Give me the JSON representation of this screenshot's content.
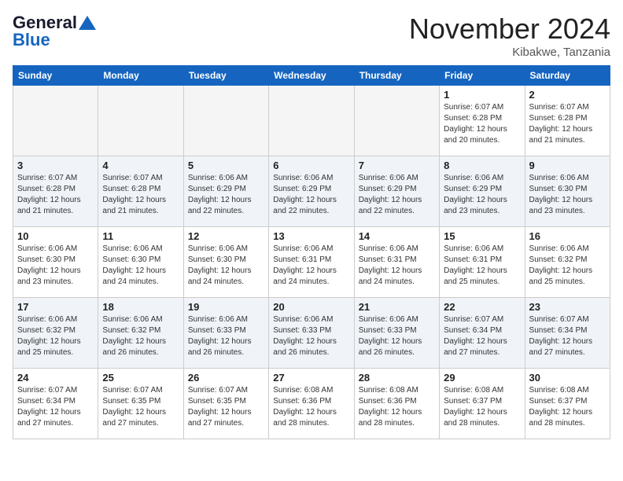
{
  "header": {
    "logo_line1": "General",
    "logo_line2": "Blue",
    "month_title": "November 2024",
    "location": "Kibakwe, Tanzania"
  },
  "days_of_week": [
    "Sunday",
    "Monday",
    "Tuesday",
    "Wednesday",
    "Thursday",
    "Friday",
    "Saturday"
  ],
  "weeks": [
    [
      {
        "day": "",
        "info": ""
      },
      {
        "day": "",
        "info": ""
      },
      {
        "day": "",
        "info": ""
      },
      {
        "day": "",
        "info": ""
      },
      {
        "day": "",
        "info": ""
      },
      {
        "day": "1",
        "info": "Sunrise: 6:07 AM\nSunset: 6:28 PM\nDaylight: 12 hours and 20 minutes."
      },
      {
        "day": "2",
        "info": "Sunrise: 6:07 AM\nSunset: 6:28 PM\nDaylight: 12 hours and 21 minutes."
      }
    ],
    [
      {
        "day": "3",
        "info": "Sunrise: 6:07 AM\nSunset: 6:28 PM\nDaylight: 12 hours and 21 minutes."
      },
      {
        "day": "4",
        "info": "Sunrise: 6:07 AM\nSunset: 6:28 PM\nDaylight: 12 hours and 21 minutes."
      },
      {
        "day": "5",
        "info": "Sunrise: 6:06 AM\nSunset: 6:29 PM\nDaylight: 12 hours and 22 minutes."
      },
      {
        "day": "6",
        "info": "Sunrise: 6:06 AM\nSunset: 6:29 PM\nDaylight: 12 hours and 22 minutes."
      },
      {
        "day": "7",
        "info": "Sunrise: 6:06 AM\nSunset: 6:29 PM\nDaylight: 12 hours and 22 minutes."
      },
      {
        "day": "8",
        "info": "Sunrise: 6:06 AM\nSunset: 6:29 PM\nDaylight: 12 hours and 23 minutes."
      },
      {
        "day": "9",
        "info": "Sunrise: 6:06 AM\nSunset: 6:30 PM\nDaylight: 12 hours and 23 minutes."
      }
    ],
    [
      {
        "day": "10",
        "info": "Sunrise: 6:06 AM\nSunset: 6:30 PM\nDaylight: 12 hours and 23 minutes."
      },
      {
        "day": "11",
        "info": "Sunrise: 6:06 AM\nSunset: 6:30 PM\nDaylight: 12 hours and 24 minutes."
      },
      {
        "day": "12",
        "info": "Sunrise: 6:06 AM\nSunset: 6:30 PM\nDaylight: 12 hours and 24 minutes."
      },
      {
        "day": "13",
        "info": "Sunrise: 6:06 AM\nSunset: 6:31 PM\nDaylight: 12 hours and 24 minutes."
      },
      {
        "day": "14",
        "info": "Sunrise: 6:06 AM\nSunset: 6:31 PM\nDaylight: 12 hours and 24 minutes."
      },
      {
        "day": "15",
        "info": "Sunrise: 6:06 AM\nSunset: 6:31 PM\nDaylight: 12 hours and 25 minutes."
      },
      {
        "day": "16",
        "info": "Sunrise: 6:06 AM\nSunset: 6:32 PM\nDaylight: 12 hours and 25 minutes."
      }
    ],
    [
      {
        "day": "17",
        "info": "Sunrise: 6:06 AM\nSunset: 6:32 PM\nDaylight: 12 hours and 25 minutes."
      },
      {
        "day": "18",
        "info": "Sunrise: 6:06 AM\nSunset: 6:32 PM\nDaylight: 12 hours and 26 minutes."
      },
      {
        "day": "19",
        "info": "Sunrise: 6:06 AM\nSunset: 6:33 PM\nDaylight: 12 hours and 26 minutes."
      },
      {
        "day": "20",
        "info": "Sunrise: 6:06 AM\nSunset: 6:33 PM\nDaylight: 12 hours and 26 minutes."
      },
      {
        "day": "21",
        "info": "Sunrise: 6:06 AM\nSunset: 6:33 PM\nDaylight: 12 hours and 26 minutes."
      },
      {
        "day": "22",
        "info": "Sunrise: 6:07 AM\nSunset: 6:34 PM\nDaylight: 12 hours and 27 minutes."
      },
      {
        "day": "23",
        "info": "Sunrise: 6:07 AM\nSunset: 6:34 PM\nDaylight: 12 hours and 27 minutes."
      }
    ],
    [
      {
        "day": "24",
        "info": "Sunrise: 6:07 AM\nSunset: 6:34 PM\nDaylight: 12 hours and 27 minutes."
      },
      {
        "day": "25",
        "info": "Sunrise: 6:07 AM\nSunset: 6:35 PM\nDaylight: 12 hours and 27 minutes."
      },
      {
        "day": "26",
        "info": "Sunrise: 6:07 AM\nSunset: 6:35 PM\nDaylight: 12 hours and 27 minutes."
      },
      {
        "day": "27",
        "info": "Sunrise: 6:08 AM\nSunset: 6:36 PM\nDaylight: 12 hours and 28 minutes."
      },
      {
        "day": "28",
        "info": "Sunrise: 6:08 AM\nSunset: 6:36 PM\nDaylight: 12 hours and 28 minutes."
      },
      {
        "day": "29",
        "info": "Sunrise: 6:08 AM\nSunset: 6:37 PM\nDaylight: 12 hours and 28 minutes."
      },
      {
        "day": "30",
        "info": "Sunrise: 6:08 AM\nSunset: 6:37 PM\nDaylight: 12 hours and 28 minutes."
      }
    ]
  ]
}
